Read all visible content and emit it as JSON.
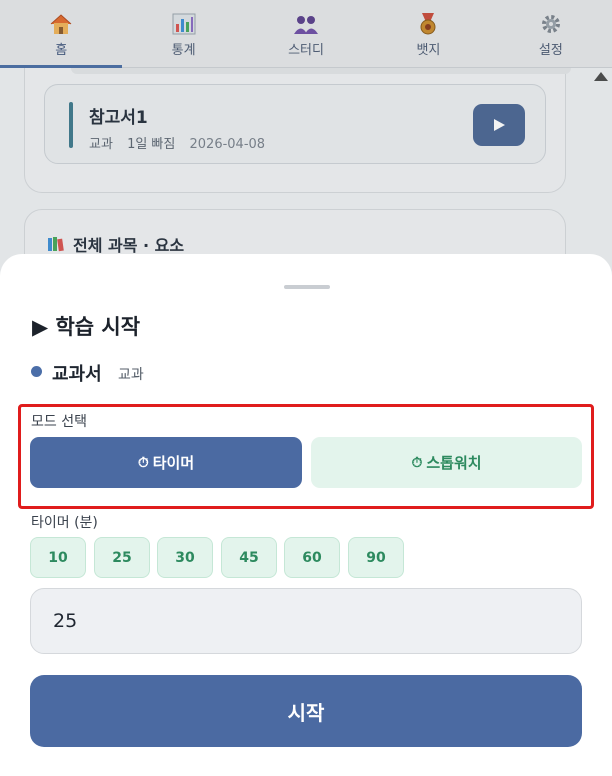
{
  "tabs": [
    {
      "label": "홈",
      "icon": "home-icon",
      "active": true
    },
    {
      "label": "통계",
      "icon": "bar-chart-icon",
      "active": false
    },
    {
      "label": "스터디",
      "icon": "group-icon",
      "active": false
    },
    {
      "label": "뱃지",
      "icon": "medal-icon",
      "active": false
    },
    {
      "label": "설정",
      "icon": "gear-icon",
      "active": false
    }
  ],
  "background": {
    "reference_card": {
      "title": "참고서1",
      "subject": "교과",
      "status": "1일 빠짐",
      "date": "2026-04-08"
    },
    "section_title": "전체 과목 · 요소"
  },
  "sheet": {
    "title": "▶ 학습 시작",
    "subject_name": "교과서",
    "subject_type": "교과",
    "mode_label": "모드 선택",
    "mode_timer": "타이머",
    "mode_stopwatch": "스톱워치",
    "timer_label": "타이머 (분)",
    "presets": [
      "10",
      "25",
      "30",
      "45",
      "60",
      "90"
    ],
    "minutes_value": "25",
    "start_label": "시작"
  },
  "colors": {
    "primary": "#4b6aa2",
    "secondary_bg": "#e3f4ec",
    "secondary_text": "#2d8a5f",
    "highlight_border": "#e01c1c"
  }
}
